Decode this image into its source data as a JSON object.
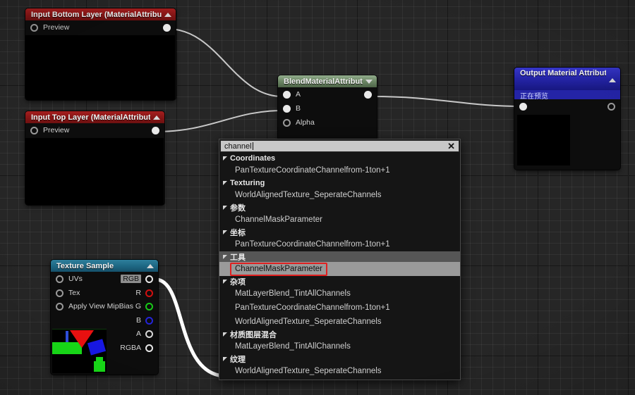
{
  "app": {
    "name": "Unreal Engine Material Editor Graph"
  },
  "nodes": {
    "input_bottom": {
      "title": "Input Bottom Layer (MaterialAttributes)",
      "collapse_icon": "triangle-up-icon",
      "header_color": "#8a1616",
      "pins": [
        {
          "name": "Preview",
          "type": "input",
          "shape": "hollow"
        }
      ],
      "out_pin": {
        "name": "output-pin",
        "shape": "solid"
      }
    },
    "input_top": {
      "title": "Input Top Layer (MaterialAttributes)",
      "collapse_icon": "triangle-up-icon",
      "header_color": "#8a1616",
      "pins": [
        {
          "name": "Preview",
          "type": "input",
          "shape": "hollow"
        }
      ],
      "out_pin": {
        "name": "output-pin",
        "shape": "solid"
      }
    },
    "blend": {
      "title": "BlendMaterialAttributes",
      "collapse_icon": "triangle-down-icon",
      "header_color": "#6f8a68",
      "inputs": [
        {
          "label": "A",
          "shape": "solid"
        },
        {
          "label": "B",
          "shape": "solid"
        },
        {
          "label": "Alpha",
          "shape": "hollow"
        }
      ],
      "outputs": [
        {
          "label": "",
          "shape": "solid"
        }
      ]
    },
    "output_material": {
      "title": "Output Material Attributes",
      "collapse_icon": "triangle-up-icon",
      "header_color": "#2424a6",
      "status": "正在预览",
      "inputs": [
        {
          "label": "",
          "shape": "solid"
        }
      ],
      "outputs": [
        {
          "label": "",
          "shape": "hollow"
        }
      ]
    },
    "texture_sample": {
      "title": "Texture Sample",
      "collapse_icon": "triangle-up-icon",
      "header_color": "#1f6a86",
      "inputs": [
        {
          "label": "UVs",
          "shape": "hollow"
        },
        {
          "label": "Tex",
          "shape": "hollow"
        },
        {
          "label": "Apply View MipBias",
          "shape": "hollow"
        }
      ],
      "outputs": [
        {
          "label": "RGB",
          "color": "#e9e9e9",
          "selected": true
        },
        {
          "label": "R",
          "color": "#d01010",
          "selected": false
        },
        {
          "label": "G",
          "color": "#18c818",
          "selected": false
        },
        {
          "label": "B",
          "color": "#2424d8",
          "selected": false
        },
        {
          "label": "A",
          "color": "#d8d8d8",
          "selected": false
        },
        {
          "label": "RGBA",
          "color": "#e9e9e9",
          "selected": false
        }
      ]
    }
  },
  "menu": {
    "search": {
      "value": "channel",
      "placeholder": "",
      "clear_icon": "close-icon"
    },
    "groups": [
      {
        "category": "Coordinates",
        "selected": false,
        "items": [
          {
            "label": "PanTextureCoordinateChannelfrom-1ton+1",
            "highlighted": false
          }
        ]
      },
      {
        "category": "Texturing",
        "selected": false,
        "items": [
          {
            "label": "WorldAlignedTexture_SeperateChannels",
            "highlighted": false
          }
        ]
      },
      {
        "category": "参数",
        "selected": false,
        "items": [
          {
            "label": "ChannelMaskParameter",
            "highlighted": false
          }
        ]
      },
      {
        "category": "坐标",
        "selected": false,
        "items": [
          {
            "label": "PanTextureCoordinateChannelfrom-1ton+1",
            "highlighted": false
          }
        ]
      },
      {
        "category": "工具",
        "selected": true,
        "items": [
          {
            "label": "ChannelMaskParameter",
            "highlighted": true
          }
        ]
      },
      {
        "category": "杂项",
        "selected": false,
        "items": [
          {
            "label": "MatLayerBlend_TintAllChannels",
            "highlighted": false
          },
          {
            "label": "PanTextureCoordinateChannelfrom-1ton+1",
            "highlighted": false
          },
          {
            "label": "WorldAlignedTexture_SeperateChannels",
            "highlighted": false
          }
        ]
      },
      {
        "category": "材质图层混合",
        "selected": false,
        "items": [
          {
            "label": "MatLayerBlend_TintAllChannels",
            "highlighted": false
          }
        ]
      },
      {
        "category": "纹理",
        "selected": false,
        "items": [
          {
            "label": "WorldAlignedTexture_SeperateChannels",
            "highlighted": false
          }
        ]
      }
    ]
  },
  "colors": {
    "accent_red": "#8a1616",
    "accent_green": "#6f8a68",
    "accent_blue": "#2424a6",
    "accent_teal": "#1f6a86",
    "highlight_box": "#e02020",
    "wire": "#c8c8c8",
    "drag_wire": "#ffffff"
  }
}
